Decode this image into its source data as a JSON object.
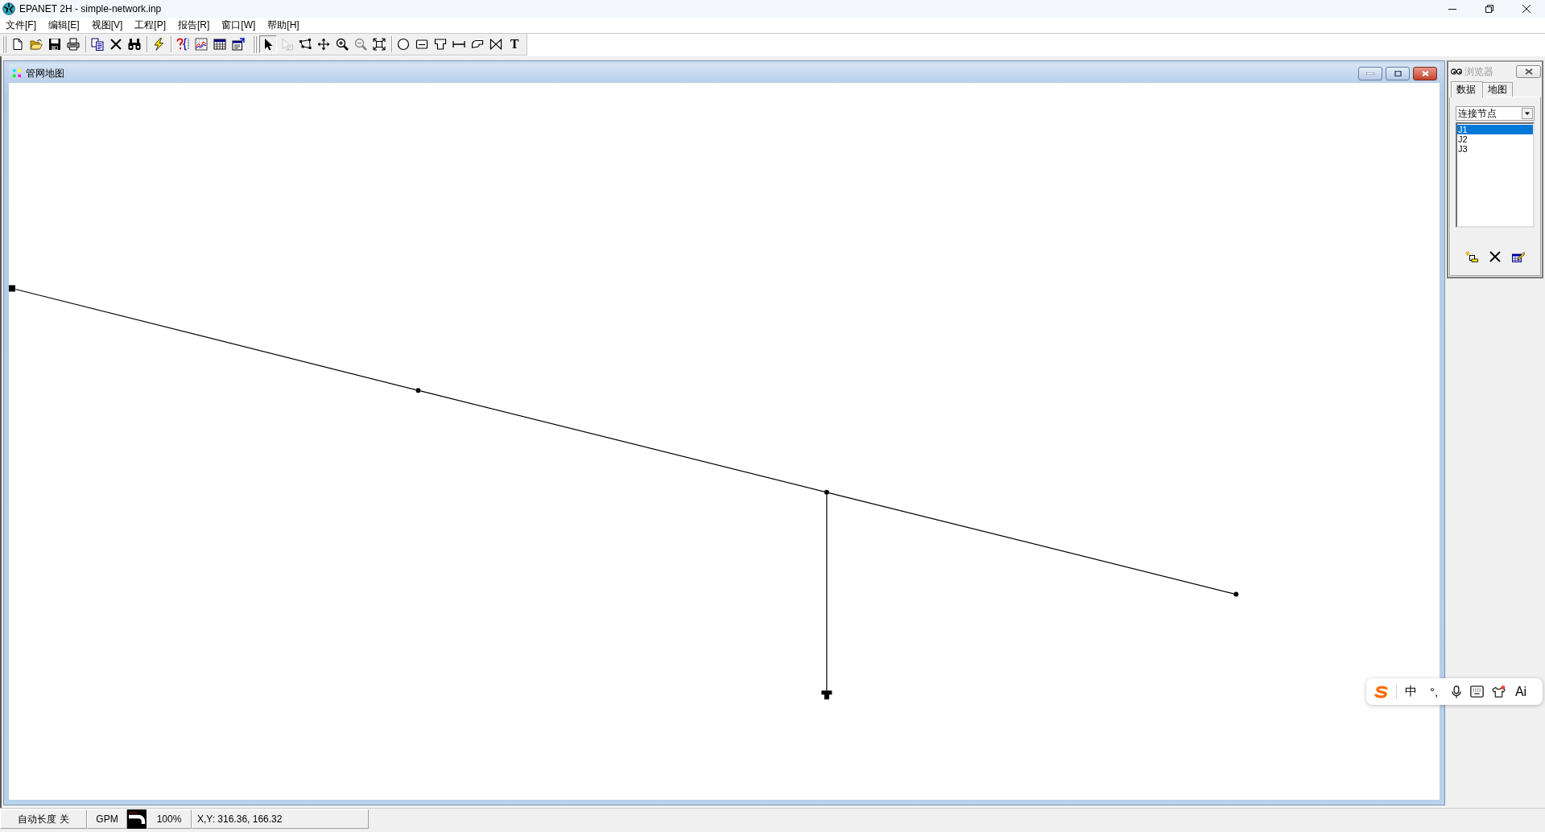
{
  "window": {
    "title": "EPANET 2H - simple-network.inp"
  },
  "menu": [
    "文件[F]",
    "编辑[E]",
    "视图[V]",
    "工程[P]",
    "报告[R]",
    "窗口[W]",
    "帮助[H]"
  ],
  "toolbars": [
    {
      "groups": [
        {
          "buttons": [
            {
              "kind": "new",
              "selected": false,
              "disabled": false
            },
            {
              "kind": "open",
              "selected": false,
              "disabled": false
            },
            {
              "kind": "save",
              "selected": false,
              "disabled": false
            },
            {
              "kind": "print",
              "selected": false,
              "disabled": false
            }
          ]
        },
        {
          "buttons": [
            {
              "kind": "copy",
              "selected": false,
              "disabled": false
            },
            {
              "kind": "delete",
              "selected": false,
              "disabled": false
            },
            {
              "kind": "find",
              "selected": false,
              "disabled": false
            }
          ]
        },
        {
          "buttons": [
            {
              "kind": "run",
              "selected": false,
              "disabled": false
            }
          ]
        },
        {
          "buttons": [
            {
              "kind": "query",
              "selected": false,
              "disabled": false
            },
            {
              "kind": "graph",
              "selected": false,
              "disabled": false
            },
            {
              "kind": "table",
              "selected": false,
              "disabled": false
            },
            {
              "kind": "options",
              "selected": false,
              "disabled": false
            }
          ]
        }
      ]
    },
    {
      "groups": [
        {
          "buttons": [
            {
              "kind": "select",
              "selected": true,
              "disabled": false
            },
            {
              "kind": "vertex",
              "selected": false,
              "disabled": true
            },
            {
              "kind": "polygon",
              "selected": false,
              "disabled": false
            },
            {
              "kind": "pan",
              "selected": false,
              "disabled": false
            },
            {
              "kind": "zoom_in",
              "selected": false,
              "disabled": false
            },
            {
              "kind": "zoom_out",
              "selected": false,
              "disabled": true
            },
            {
              "kind": "full_extent",
              "selected": false,
              "disabled": false
            }
          ]
        },
        {
          "buttons": [
            {
              "kind": "junction",
              "selected": false,
              "disabled": false
            },
            {
              "kind": "reservoir",
              "selected": false,
              "disabled": false
            },
            {
              "kind": "tank",
              "selected": false,
              "disabled": false
            },
            {
              "kind": "pipe",
              "selected": false,
              "disabled": false
            },
            {
              "kind": "pump",
              "selected": false,
              "disabled": false
            },
            {
              "kind": "valve",
              "selected": false,
              "disabled": false
            },
            {
              "kind": "label",
              "glyph": "T",
              "selected": false,
              "disabled": false
            }
          ]
        }
      ]
    }
  ],
  "map_window": {
    "title": "管网地图",
    "active": true
  },
  "browser": {
    "title": "浏览器",
    "active": false,
    "tabs": [
      {
        "label": "数据",
        "selected": true
      },
      {
        "label": "地图",
        "selected": false
      }
    ],
    "dropdown": {
      "value": "连接节点"
    },
    "items": [
      {
        "label": "J1",
        "selected": true
      },
      {
        "label": "J2",
        "selected": false
      },
      {
        "label": "J3",
        "selected": false
      }
    ]
  },
  "status_bar": {
    "auto_length": "自动长度 关",
    "flow_units": "GPM",
    "zoom": "100%",
    "coordinates": "X,Y: 316.36, 166.32"
  },
  "ime_toolbar": {
    "mode": "中",
    "punctuation": "°,",
    "assistant": "Ai"
  }
}
